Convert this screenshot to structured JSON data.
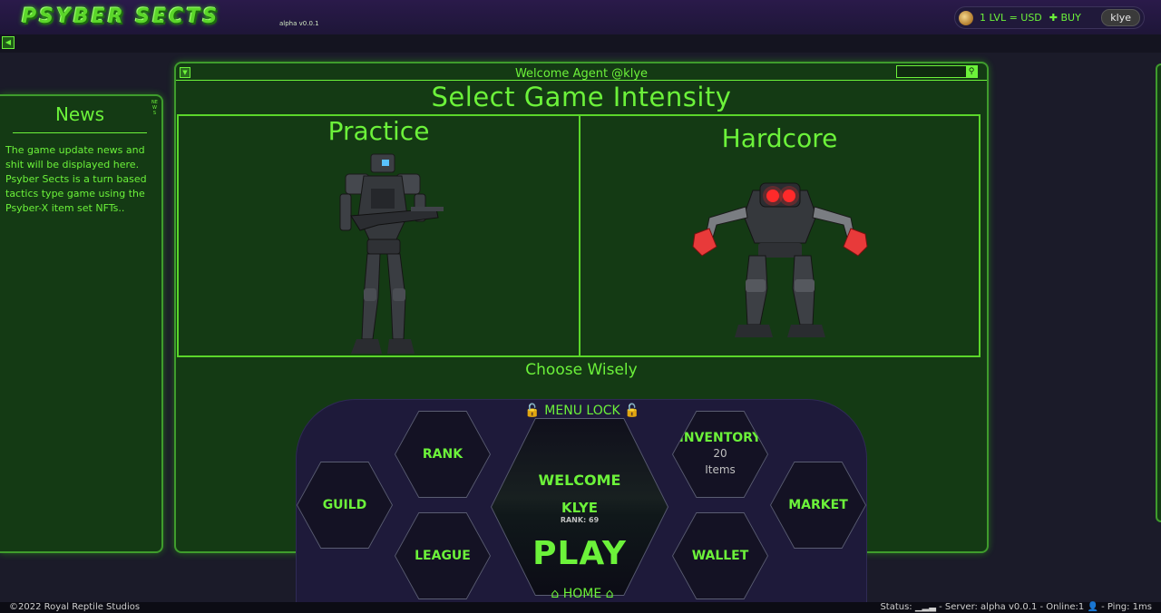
{
  "header": {
    "logo_text": "PSYBER SECTS",
    "version": "alpha v0.0.1",
    "rate": "1 LVL = USD",
    "buy_label": "✚ BUY",
    "username": "klye"
  },
  "news": {
    "tab_label": "NEWS",
    "title": "News",
    "body": "The game update news and shit will be displayed here. Psyber Sects is a turn based tactics type game using the Psyber-X item set NFTs.."
  },
  "main": {
    "welcome_line": "Welcome Agent @klye",
    "title": "Select Game Intensity",
    "cards": [
      {
        "title": "Practice"
      },
      {
        "title": "Hardcore"
      }
    ],
    "footer_text": "Choose Wisely"
  },
  "menu": {
    "lock_label": "🔓 MENU LOCK 🔓",
    "home_label": "⌂ HOME ⌂",
    "rank": "RANK",
    "guild": "GUILD",
    "league": "LEAGUE",
    "inventory": "INVENTORY",
    "inventory_count": "20",
    "inventory_unit": "Items",
    "market": "MARKET",
    "wallet": "WALLET",
    "center": {
      "welcome": "WELCOME",
      "name": "KLYE",
      "rank": "RANK: 69",
      "play": "PLAY"
    }
  },
  "footer": {
    "copyright": "©2022 Royal Reptile Studios",
    "status": "Status: ▁▂▃ - Server: alpha v0.0.1 - Online:1 👤 - Ping: 1ms"
  },
  "colors": {
    "accent": "#6cf23a",
    "panel_bg": "#143a14",
    "page_bg": "#1b1b29",
    "dock_bg": "#1e1a3a"
  }
}
